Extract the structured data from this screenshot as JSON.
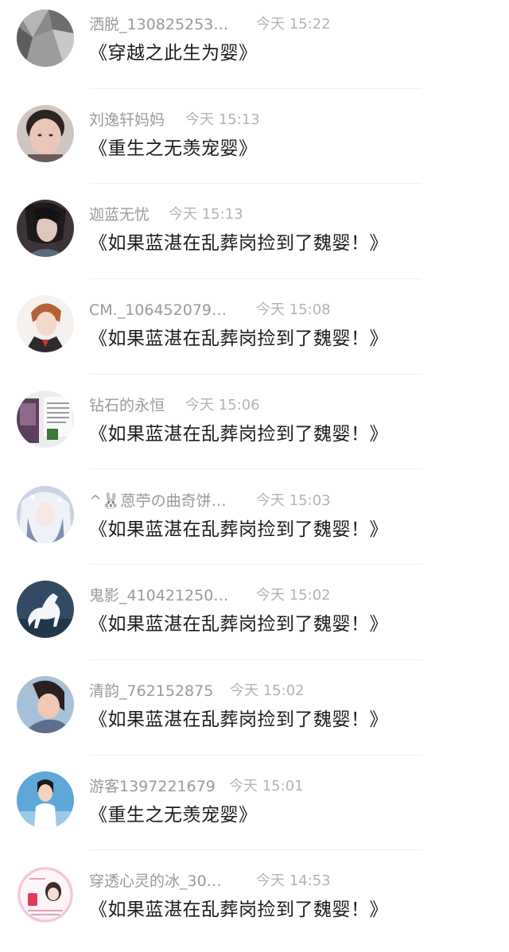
{
  "messages": [
    {
      "name": "洒脱_130825253…",
      "time": "今天 15:22",
      "book": "《穿越之此生为婴》",
      "avatar": "avatar-grey-abstract"
    },
    {
      "name": "刘逸轩妈妈",
      "time": "今天 15:13",
      "book": "《重生之无羡宠婴》",
      "avatar": "avatar-woman-selfie"
    },
    {
      "name": "迦蓝无忧",
      "time": "今天 15:13",
      "book": "《如果蓝湛在乱葬岗捡到了魏婴！》",
      "avatar": "avatar-portrait-dark"
    },
    {
      "name": "CM._106452079…",
      "time": "今天 15:08",
      "book": "《如果蓝湛在乱葬岗捡到了魏婴！》",
      "avatar": "avatar-anime-boy"
    },
    {
      "name": "钻石的永恒",
      "time": "今天 15:06",
      "book": "《如果蓝湛在乱葬岗捡到了魏婴！》",
      "avatar": "avatar-text-collage"
    },
    {
      "name": "^🐰蒽苧の曲奇饼…",
      "time": "今天 15:03",
      "book": "《如果蓝湛在乱葬岗捡到了魏婴！》",
      "avatar": "avatar-anime-girl-white"
    },
    {
      "name": "鬼影_410421250…",
      "time": "今天 15:02",
      "book": "《如果蓝湛在乱葬岗捡到了魏婴！》",
      "avatar": "avatar-white-horse"
    },
    {
      "name": "清韵_762152875",
      "time": "今天 15:02",
      "book": "《如果蓝湛在乱葬岗捡到了魏婴！》",
      "avatar": "avatar-woman-photo"
    },
    {
      "name": "游客1397221679",
      "time": "今天 15:01",
      "book": "《重生之无羡宠婴》",
      "avatar": "avatar-boy-blue-sky"
    },
    {
      "name": "穿透心灵的冰_30…",
      "time": "今天 14:53",
      "book": "《如果蓝湛在乱葬岗捡到了魏婴！》",
      "avatar": "avatar-cartoon-girl-pink"
    }
  ]
}
